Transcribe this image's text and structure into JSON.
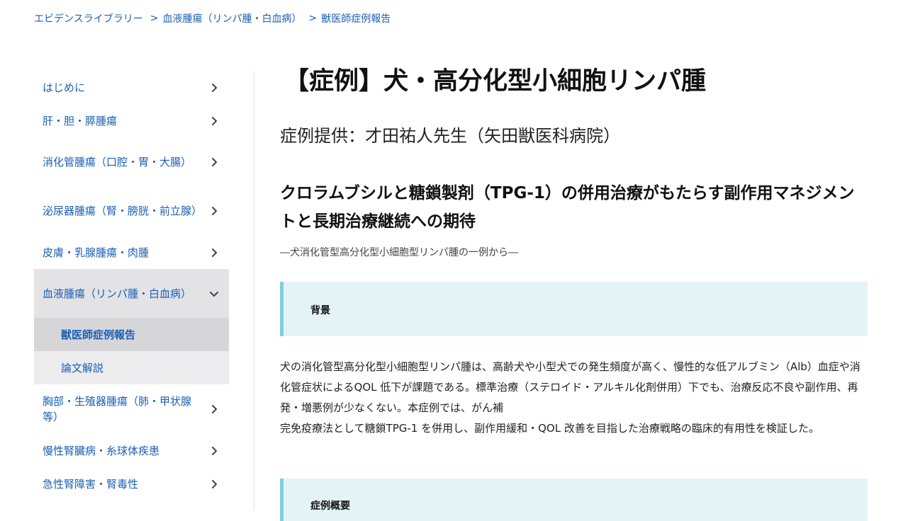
{
  "breadcrumb": {
    "items": [
      "エビデンスライブラリー",
      "血液腫瘍（リンパ腫・白血病）",
      "獣医師症例報告"
    ],
    "separator": ">"
  },
  "sidebar": {
    "items": [
      {
        "label": "はじめに"
      },
      {
        "label": "肝・胆・膵腫瘍"
      },
      {
        "label": "消化管腫瘍（口腔・胃・大腸）"
      },
      {
        "label": "泌尿器腫瘍（腎・膀胱・前立腺）"
      },
      {
        "label": "皮膚・乳腺腫瘍・肉腫"
      },
      {
        "label": "血液腫瘍（リンパ腫・白血病）",
        "expanded": true,
        "children": [
          {
            "label": "獣医師症例報告",
            "current": true
          },
          {
            "label": "論文解説"
          }
        ]
      },
      {
        "label": "胸部・生殖器腫瘍（肺・甲状腺等）"
      },
      {
        "label": "慢性腎臓病・糸球体疾患"
      },
      {
        "label": "急性腎障害・腎毒性"
      }
    ]
  },
  "main": {
    "title": "【症例】犬・高分化型小細胞リンパ腫",
    "provider": "症例提供：才田祐人先生（矢田獣医科病院）",
    "subtitle": "クロラムブシルと糖鎖製剤（TPG-1）の併用治療がもたらす副作用マネジメントと長期治療継続への期待",
    "lead": "―犬消化管型高分化型小細胞型リンパ腫の一例から―",
    "sections": [
      {
        "title": "背景"
      },
      {
        "title": "症例概要"
      }
    ],
    "background_text": [
      "犬の消化管型高分化型小細胞型リンパ腫は、高齢犬や小型犬での発生頻度が高く、慢性的な低アルブミン（Alb）血症や消化管症状によるQOL 低下が課題である。標準治療（ステロイド・アルキル化剤併用）下でも、治療反応不良や副作用、再発・増悪例が少なくない。本症例では、がん補",
      "完免疫療法として糖鎖TPG-1 を併用し、副作用緩和・QOL 改善を目指した治療戦略の臨床的有用性を検証した。"
    ]
  },
  "colors": {
    "link": "#1a5fb4",
    "active_bg": "#e3e3e5",
    "section_bg": "#e4f3f6",
    "section_border": "#7fd0d8"
  },
  "icons": {
    "collapsed": "chevron-right-icon",
    "expanded": "chevron-down-icon"
  }
}
